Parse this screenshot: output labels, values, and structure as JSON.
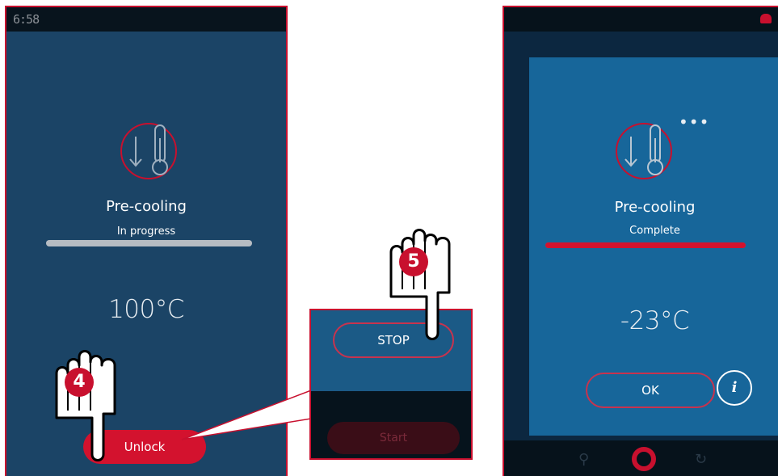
{
  "left_screen": {
    "clock": "6:58",
    "title": "Pre-cooling",
    "status": "In progress",
    "temperature": "100°C",
    "progress": 1.0,
    "progress_color": "#b6bcc2",
    "unlock_label": "Unlock",
    "icon": "pre-cooling-thermometer-icon"
  },
  "middle_panel": {
    "stop_label": "STOP",
    "start_label": "Start"
  },
  "right_screen": {
    "title": "Pre-cooling",
    "status": "Complete",
    "temperature": "-23°C",
    "progress": 1.0,
    "progress_color": "#d3122e",
    "ok_label": "OK",
    "info_label": "i",
    "dots": "•••",
    "icon": "pre-cooling-thermometer-icon"
  },
  "steps": {
    "step4": "4",
    "step5": "5"
  },
  "colors": {
    "accent_red": "#c8102e",
    "screen_blue": "#1b4466",
    "dialog_blue": "#17669a"
  }
}
